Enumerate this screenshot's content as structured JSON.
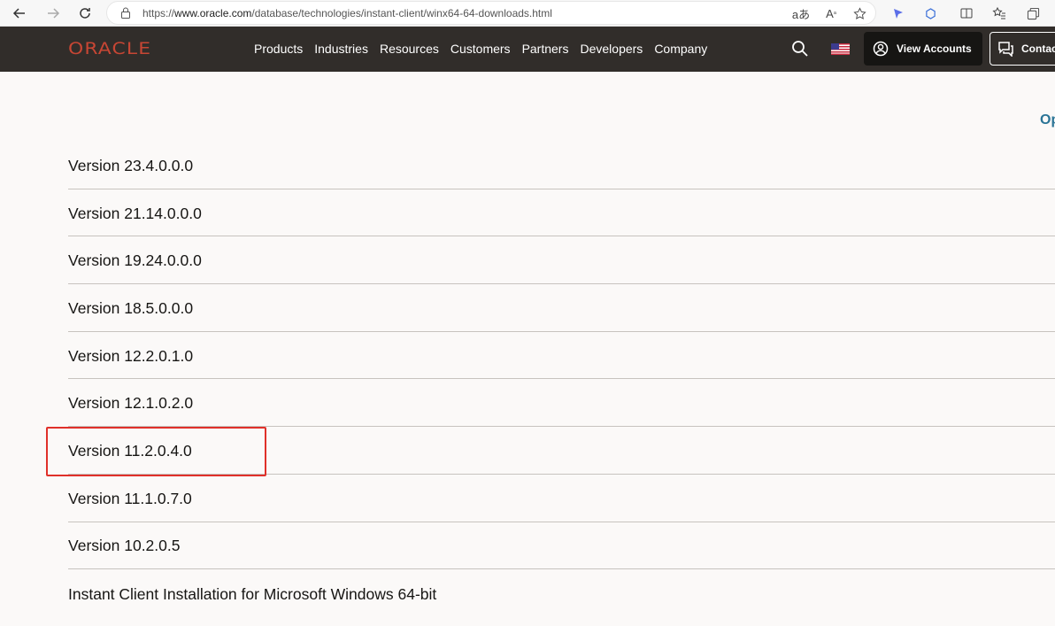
{
  "browser": {
    "url_prefix": "https://",
    "url_host": "www.oracle.com",
    "url_path": "/database/technologies/instant-client/winx64-64-downloads.html"
  },
  "header": {
    "logo": "ORACLE",
    "nav": [
      "Products",
      "Industries",
      "Resources",
      "Customers",
      "Partners",
      "Developers",
      "Company"
    ],
    "view_accounts": "View Accounts",
    "contact": "Contac"
  },
  "side_text": "Op",
  "versions": [
    "Version 23.4.0.0.0",
    "Version 21.14.0.0.0",
    "Version 19.24.0.0.0",
    "Version 18.5.0.0.0",
    "Version 12.2.0.1.0",
    "Version 12.1.0.2.0",
    "Version 11.2.0.4.0",
    "Version 11.1.0.7.0",
    "Version 10.2.0.5",
    "Instant Client Installation for Microsoft Windows 64-bit"
  ],
  "highlighted_version": "Version 11.2.0.4.0",
  "colors": {
    "header_bg": "#312d2a",
    "logo_red": "#c74634",
    "highlight_red": "#e0302a",
    "link_teal": "#2a7496"
  }
}
